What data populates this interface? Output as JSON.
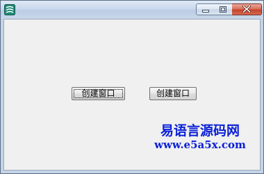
{
  "window": {
    "title": "",
    "icons": {
      "app": "app-logo-icon",
      "minimize": "minimize-icon",
      "maximize": "maximize-icon",
      "close": "close-icon"
    }
  },
  "client": {
    "buttons": [
      {
        "label": "创建窗口",
        "focused": true
      },
      {
        "label": "创建窗口",
        "focused": false
      }
    ]
  },
  "watermark": {
    "title": "易语言源码网",
    "url": "www.e5a5x.com",
    "color": "#0a1fd8"
  },
  "colors": {
    "close_button": "#c5432b",
    "client_background": "#f0f0f0",
    "titlebar": "#c8d7ea"
  }
}
